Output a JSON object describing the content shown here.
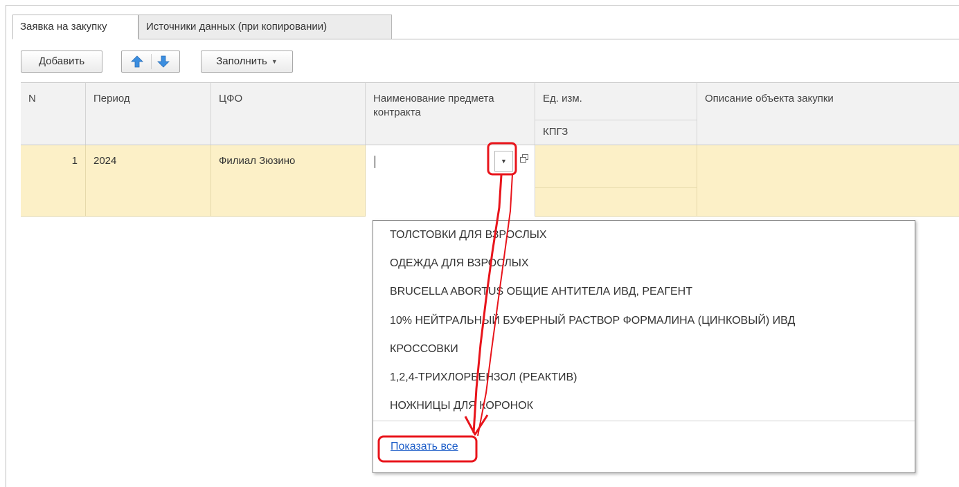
{
  "tabs": {
    "active": "Заявка на закупку",
    "inactive": "Источники данных (при копировании)"
  },
  "toolbar": {
    "add_label": "Добавить",
    "fill_label": "Заполнить",
    "up_icon": "arrow-up-icon",
    "down_icon": "arrow-down-icon"
  },
  "table": {
    "headers": {
      "n": "N",
      "period": "Период",
      "cfo": "ЦФО",
      "name_line1": "Наименование предмета",
      "name_line2": "контракта",
      "unit": "Ед. изм.",
      "kpgz": "КПГЗ",
      "description": "Описание объекта закупки"
    },
    "row": {
      "n": "1",
      "period": "2024",
      "cfo": "Филиал Зюзино",
      "name": ""
    }
  },
  "dropdown": {
    "items": [
      "ТОЛСТОВКИ ДЛЯ ВЗРОСЛЫХ",
      "ОДЕЖДА ДЛЯ ВЗРОСЛЫХ",
      "BRUCELLA ABORTUS ОБЩИЕ АНТИТЕЛА ИВД, РЕАГЕНТ",
      "10% НЕЙТРАЛЬНЫЙ БУФЕРНЫЙ РАСТВОР ФОРМАЛИНА (ЦИНКОВЫЙ) ИВД",
      "КРОССОВКИ",
      "1,2,4-ТРИХЛОРБЕНЗОЛ (РЕАКТИВ)",
      "НОЖНИЦЫ ДЛЯ КОРОНОК"
    ],
    "show_all": "Показать все"
  },
  "colors": {
    "row_highlight": "#fcf0c7",
    "link": "#1f5fc9",
    "annotation": "#e8141b",
    "arrow_icon": "#3b8ee0"
  }
}
